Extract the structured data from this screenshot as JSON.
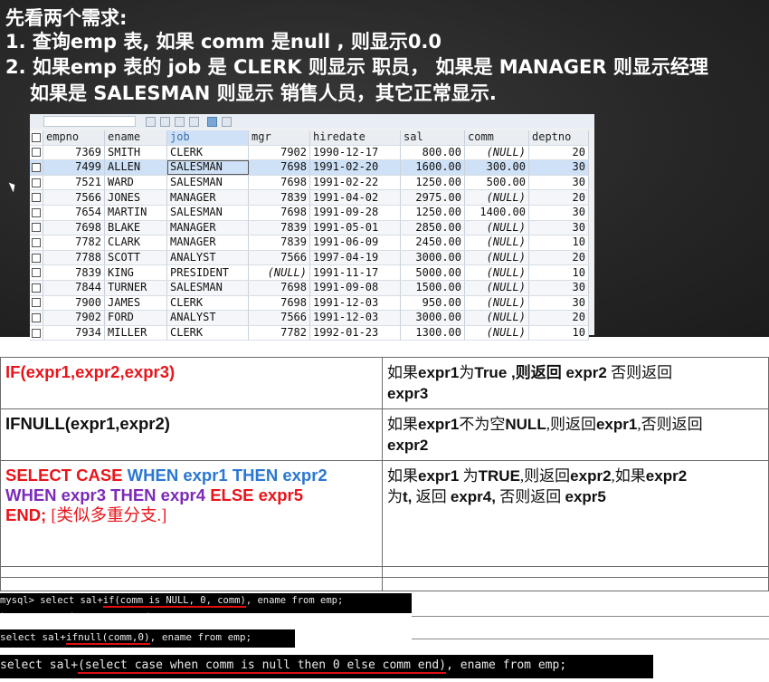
{
  "headings": {
    "line0": "先看两个需求:",
    "line1": "1. 查询emp 表, 如果 comm 是null , 则显示0.0",
    "line2": "2. 如果emp 表的 job 是 CLERK 则显示 职员， 如果是 MANAGER 则显示经理",
    "line3": "如果是 SALESMAN 则显示 销售人员，其它正常显示."
  },
  "emp_table": {
    "columns": [
      "empno",
      "ename",
      "job",
      "mgr",
      "hiredate",
      "sal",
      "comm",
      "deptno"
    ],
    "rows": [
      [
        "7369",
        "SMITH",
        "CLERK",
        "7902",
        "1990-12-17",
        "800.00",
        "(NULL)",
        "20"
      ],
      [
        "7499",
        "ALLEN",
        "SALESMAN",
        "7698",
        "1991-02-20",
        "1600.00",
        "300.00",
        "30"
      ],
      [
        "7521",
        "WARD",
        "SALESMAN",
        "7698",
        "1991-02-22",
        "1250.00",
        "500.00",
        "30"
      ],
      [
        "7566",
        "JONES",
        "MANAGER",
        "7839",
        "1991-04-02",
        "2975.00",
        "(NULL)",
        "20"
      ],
      [
        "7654",
        "MARTIN",
        "SALESMAN",
        "7698",
        "1991-09-28",
        "1250.00",
        "1400.00",
        "30"
      ],
      [
        "7698",
        "BLAKE",
        "MANAGER",
        "7839",
        "1991-05-01",
        "2850.00",
        "(NULL)",
        "30"
      ],
      [
        "7782",
        "CLARK",
        "MANAGER",
        "7839",
        "1991-06-09",
        "2450.00",
        "(NULL)",
        "10"
      ],
      [
        "7788",
        "SCOTT",
        "ANALYST",
        "7566",
        "1997-04-19",
        "3000.00",
        "(NULL)",
        "20"
      ],
      [
        "7839",
        "KING",
        "PRESIDENT",
        "(NULL)",
        "1991-11-17",
        "5000.00",
        "(NULL)",
        "10"
      ],
      [
        "7844",
        "TURNER",
        "SALESMAN",
        "7698",
        "1991-09-08",
        "1500.00",
        "(NULL)",
        "30"
      ],
      [
        "7900",
        "JAMES",
        "CLERK",
        "7698",
        "1991-12-03",
        "950.00",
        "(NULL)",
        "30"
      ],
      [
        "7902",
        "FORD",
        "ANALYST",
        "7566",
        "1991-12-03",
        "3000.00",
        "(NULL)",
        "20"
      ],
      [
        "7934",
        "MILLER",
        "CLERK",
        "7782",
        "1992-01-23",
        "1300.00",
        "(NULL)",
        "10"
      ]
    ],
    "selected_row": 1
  },
  "functions": {
    "if_syntax": "IF(expr1,expr2,expr3)",
    "if_desc_pre": "如果",
    "if_desc_b1": "expr1",
    "if_desc_mid1": "为",
    "if_desc_b2": "True",
    "if_desc_mid2": " ,则返回 ",
    "if_desc_b3": "expr2",
    "if_desc_mid3": " 否则返回 ",
    "if_desc_b4": "expr3",
    "ifnull_syntax": "IFNULL(expr1,expr2)",
    "ifnull_desc_pre": "如果",
    "ifnull_desc_b1": "expr1",
    "ifnull_desc_mid1": "不为空",
    "ifnull_desc_b2": "NULL",
    "ifnull_desc_mid2": ",则返回",
    "ifnull_desc_b3": "expr1",
    "ifnull_desc_mid3": ",否则返回",
    "ifnull_desc_b4": "expr2",
    "case_select_case": "SELECT CASE",
    "case_when1": "WHEN expr1 THEN expr2",
    "case_when2": "WHEN expr3 THEN expr4",
    "case_else": "ELSE expr5",
    "case_end": "END;",
    "case_note": "[类似多重分支.]",
    "case_desc_pre": "如果",
    "case_desc_b1": "expr1",
    "case_desc_mid1": " 为",
    "case_desc_b2": "TRUE",
    "case_desc_mid2": ",则返回",
    "case_desc_b3": "expr2",
    "case_desc_mid3": ",如果",
    "case_desc_b4": "expr2",
    "case_desc_mid4": "为",
    "case_desc_b5": "t,",
    "case_desc_mid5": " 返回 ",
    "case_desc_b6": "expr4,",
    "case_desc_mid6": " 否则返回 ",
    "case_desc_b7": "expr5"
  },
  "console": {
    "q1_prefix": "mysql> select sal+",
    "q1_underlined": "if(comm is NULL, 0, comm)",
    "q1_suffix": ", ename from emp;",
    "q1_dash": "+-----------+------------+",
    "q2_prefix": "select sal+",
    "q2_underlined": "ifnull(comm,0)",
    "q2_suffix": ", ename from emp;",
    "q3_prefix": "select sal+",
    "q3_underlined": "(select case when comm is null then  0 else comm end)",
    "q3_suffix": ", ename from emp;"
  }
}
